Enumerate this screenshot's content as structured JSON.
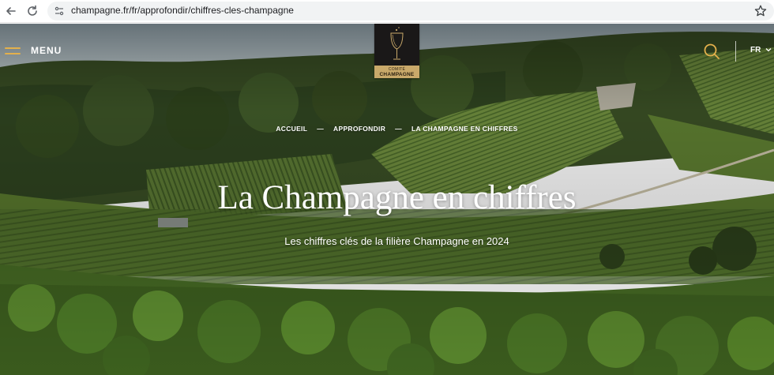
{
  "browser": {
    "url": "champagne.fr/fr/approfondir/chiffres-cles-champagne",
    "icons": [
      "back-arrow-icon",
      "reload-icon",
      "site-info-icon",
      "bookmark-star-icon"
    ]
  },
  "header": {
    "menu_label": "MENU",
    "logo": {
      "line1": "COMITÉ",
      "line2": "CHAMPAGNE"
    },
    "language": "FR"
  },
  "breadcrumb": {
    "items": [
      "ACCUEIL",
      "APPROFONDIR",
      "LA CHAMPAGNE EN CHIFFRES"
    ],
    "separator": "—"
  },
  "hero": {
    "title": "La Champagne en chiffres",
    "subtitle": "Les chiffres clés de la filière Champagne en 2024"
  },
  "colors": {
    "accent": "#e3b04c",
    "logo_gold": "#c9a96a",
    "logo_dark": "#1a1818"
  }
}
